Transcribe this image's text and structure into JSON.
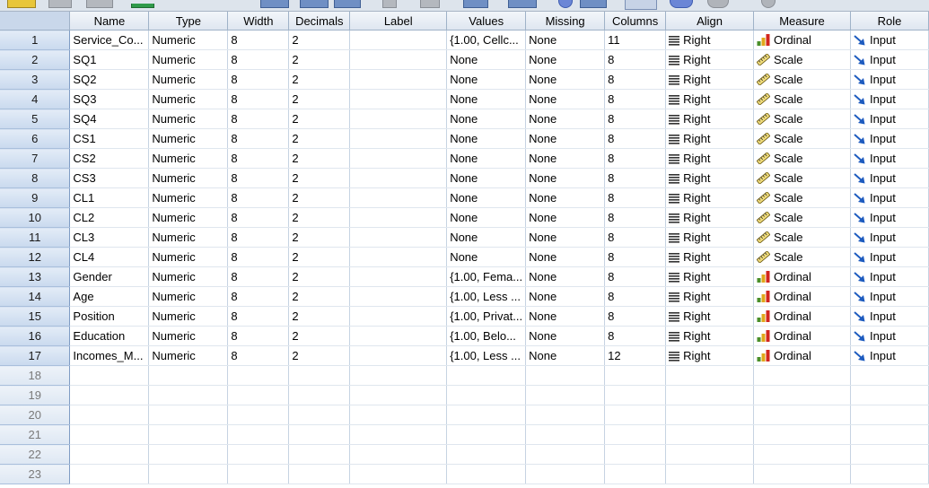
{
  "columns": [
    "Name",
    "Type",
    "Width",
    "Decimals",
    "Label",
    "Values",
    "Missing",
    "Columns",
    "Align",
    "Measure",
    "Role"
  ],
  "rows": [
    {
      "num": "1",
      "name": "Service_Co...",
      "type": "Numeric",
      "width": "8",
      "decimals": "2",
      "label": "",
      "values": "{1.00, Cellc...",
      "missing": "None",
      "columns": "11",
      "align": "Right",
      "measure": "Ordinal",
      "role": "Input"
    },
    {
      "num": "2",
      "name": "SQ1",
      "type": "Numeric",
      "width": "8",
      "decimals": "2",
      "label": "",
      "values": "None",
      "missing": "None",
      "columns": "8",
      "align": "Right",
      "measure": "Scale",
      "role": "Input"
    },
    {
      "num": "3",
      "name": "SQ2",
      "type": "Numeric",
      "width": "8",
      "decimals": "2",
      "label": "",
      "values": "None",
      "missing": "None",
      "columns": "8",
      "align": "Right",
      "measure": "Scale",
      "role": "Input"
    },
    {
      "num": "4",
      "name": "SQ3",
      "type": "Numeric",
      "width": "8",
      "decimals": "2",
      "label": "",
      "values": "None",
      "missing": "None",
      "columns": "8",
      "align": "Right",
      "measure": "Scale",
      "role": "Input"
    },
    {
      "num": "5",
      "name": "SQ4",
      "type": "Numeric",
      "width": "8",
      "decimals": "2",
      "label": "",
      "values": "None",
      "missing": "None",
      "columns": "8",
      "align": "Right",
      "measure": "Scale",
      "role": "Input"
    },
    {
      "num": "6",
      "name": "CS1",
      "type": "Numeric",
      "width": "8",
      "decimals": "2",
      "label": "",
      "values": "None",
      "missing": "None",
      "columns": "8",
      "align": "Right",
      "measure": "Scale",
      "role": "Input"
    },
    {
      "num": "7",
      "name": "CS2",
      "type": "Numeric",
      "width": "8",
      "decimals": "2",
      "label": "",
      "values": "None",
      "missing": "None",
      "columns": "8",
      "align": "Right",
      "measure": "Scale",
      "role": "Input"
    },
    {
      "num": "8",
      "name": "CS3",
      "type": "Numeric",
      "width": "8",
      "decimals": "2",
      "label": "",
      "values": "None",
      "missing": "None",
      "columns": "8",
      "align": "Right",
      "measure": "Scale",
      "role": "Input"
    },
    {
      "num": "9",
      "name": "CL1",
      "type": "Numeric",
      "width": "8",
      "decimals": "2",
      "label": "",
      "values": "None",
      "missing": "None",
      "columns": "8",
      "align": "Right",
      "measure": "Scale",
      "role": "Input"
    },
    {
      "num": "10",
      "name": "CL2",
      "type": "Numeric",
      "width": "8",
      "decimals": "2",
      "label": "",
      "values": "None",
      "missing": "None",
      "columns": "8",
      "align": "Right",
      "measure": "Scale",
      "role": "Input"
    },
    {
      "num": "11",
      "name": "CL3",
      "type": "Numeric",
      "width": "8",
      "decimals": "2",
      "label": "",
      "values": "None",
      "missing": "None",
      "columns": "8",
      "align": "Right",
      "measure": "Scale",
      "role": "Input"
    },
    {
      "num": "12",
      "name": "CL4",
      "type": "Numeric",
      "width": "8",
      "decimals": "2",
      "label": "",
      "values": "None",
      "missing": "None",
      "columns": "8",
      "align": "Right",
      "measure": "Scale",
      "role": "Input"
    },
    {
      "num": "13",
      "name": "Gender",
      "type": "Numeric",
      "width": "8",
      "decimals": "2",
      "label": "",
      "values": "{1.00, Fema...",
      "missing": "None",
      "columns": "8",
      "align": "Right",
      "measure": "Ordinal",
      "role": "Input"
    },
    {
      "num": "14",
      "name": "Age",
      "type": "Numeric",
      "width": "8",
      "decimals": "2",
      "label": "",
      "values": "{1.00, Less ...",
      "missing": "None",
      "columns": "8",
      "align": "Right",
      "measure": "Ordinal",
      "role": "Input"
    },
    {
      "num": "15",
      "name": "Position",
      "type": "Numeric",
      "width": "8",
      "decimals": "2",
      "label": "",
      "values": "{1.00, Privat...",
      "missing": "None",
      "columns": "8",
      "align": "Right",
      "measure": "Ordinal",
      "role": "Input"
    },
    {
      "num": "16",
      "name": "Education",
      "type": "Numeric",
      "width": "8",
      "decimals": "2",
      "label": "",
      "values": "{1.00, Belo...",
      "missing": "None",
      "columns": "8",
      "align": "Right",
      "measure": "Ordinal",
      "role": "Input"
    },
    {
      "num": "17",
      "name": "Incomes_M...",
      "type": "Numeric",
      "width": "8",
      "decimals": "2",
      "label": "",
      "values": "{1.00, Less ...",
      "missing": "None",
      "columns": "12",
      "align": "Right",
      "measure": "Ordinal",
      "role": "Input"
    }
  ],
  "empty_rows": [
    "18",
    "19",
    "20",
    "21",
    "22",
    "23"
  ],
  "icons": {
    "align": "align-right-icon",
    "ordinal": "ordinal-bars-icon",
    "scale": "ruler-icon",
    "role": "input-arrow-icon"
  },
  "colors": {
    "header_bg": "#dfe6f0",
    "rownum_bg": "#c9d9ee",
    "grid_line": "#c6d3e2",
    "role_arrow": "#1d5bbf"
  }
}
